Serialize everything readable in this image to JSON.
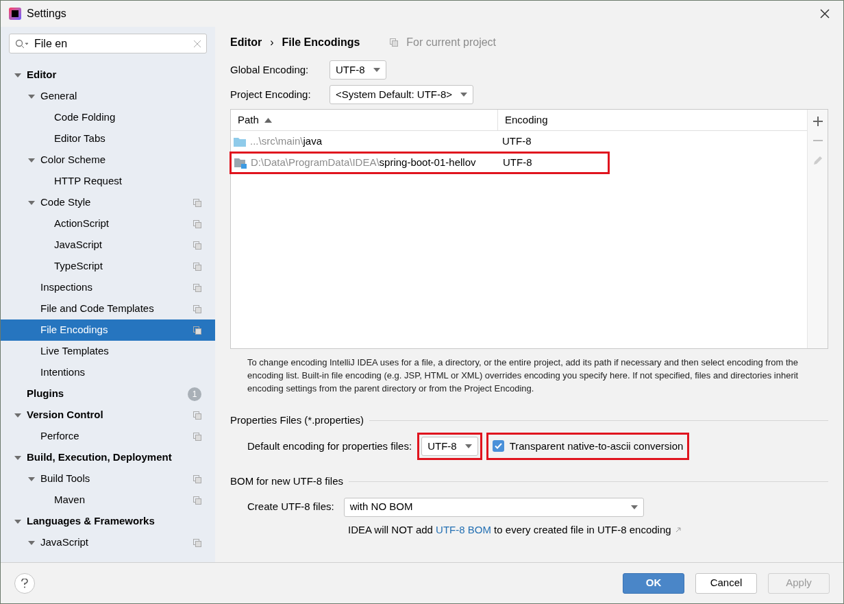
{
  "window": {
    "title": "Settings"
  },
  "search": {
    "value": "File en"
  },
  "tree": [
    {
      "label": "Editor",
      "bold": true,
      "expanded": true,
      "selected": false,
      "project_scope": false,
      "children": [
        {
          "label": "General",
          "expanded": true,
          "selected": false,
          "project_scope": false,
          "children": [
            {
              "label": "Code Folding",
              "selected": false,
              "project_scope": false
            },
            {
              "label": "Editor Tabs",
              "selected": false,
              "project_scope": false
            }
          ]
        },
        {
          "label": "Color Scheme",
          "expanded": true,
          "selected": false,
          "project_scope": false,
          "children": [
            {
              "label": "HTTP Request",
              "selected": false,
              "project_scope": false
            }
          ]
        },
        {
          "label": "Code Style",
          "expanded": true,
          "selected": false,
          "project_scope": true,
          "children": [
            {
              "label": "ActionScript",
              "selected": false,
              "project_scope": true
            },
            {
              "label": "JavaScript",
              "selected": false,
              "project_scope": true
            },
            {
              "label": "TypeScript",
              "selected": false,
              "project_scope": true
            }
          ]
        },
        {
          "label": "Inspections",
          "selected": false,
          "project_scope": true
        },
        {
          "label": "File and Code Templates",
          "selected": false,
          "project_scope": true
        },
        {
          "label": "File Encodings",
          "selected": true,
          "project_scope": true
        },
        {
          "label": "Live Templates",
          "selected": false,
          "project_scope": false
        },
        {
          "label": "Intentions",
          "selected": false,
          "project_scope": false
        }
      ]
    },
    {
      "label": "Plugins",
      "bold": true,
      "selected": false,
      "project_scope": false,
      "badge": "1"
    },
    {
      "label": "Version Control",
      "bold": true,
      "expanded": true,
      "selected": false,
      "project_scope": true,
      "children": [
        {
          "label": "Perforce",
          "selected": false,
          "project_scope": true
        }
      ]
    },
    {
      "label": "Build, Execution, Deployment",
      "bold": true,
      "expanded": true,
      "selected": false,
      "project_scope": false,
      "children": [
        {
          "label": "Build Tools",
          "expanded": true,
          "selected": false,
          "project_scope": true,
          "children": [
            {
              "label": "Maven",
              "selected": false,
              "project_scope": true
            }
          ]
        }
      ]
    },
    {
      "label": "Languages & Frameworks",
      "bold": true,
      "expanded": true,
      "selected": false,
      "project_scope": false,
      "children": [
        {
          "label": "JavaScript",
          "expanded": true,
          "selected": false,
          "project_scope": true
        }
      ]
    }
  ],
  "breadcrumb": [
    "Editor",
    "File Encodings"
  ],
  "breadcrumb_separator": "›",
  "scope_note": "For current project",
  "global_encoding": {
    "label": "Global Encoding:",
    "value": "UTF-8"
  },
  "project_encoding": {
    "label": "Project Encoding:",
    "value": "<System Default: UTF-8>"
  },
  "table": {
    "columns": [
      {
        "label": "Path",
        "sorted": true
      },
      {
        "label": "Encoding",
        "sorted": false
      }
    ],
    "rows": [
      {
        "kind": "folder",
        "path_prefix": "...\\src\\main\\",
        "path_name": "java",
        "encoding": "UTF-8",
        "highlighted": false
      },
      {
        "kind": "module",
        "path_prefix": "D:\\Data\\ProgramData\\IDEA\\",
        "path_name": "spring-boot-01-hellov",
        "encoding": "UTF-8",
        "highlighted": true
      }
    ]
  },
  "help_text": "To change encoding IntelliJ IDEA uses for a file, a directory, or the entire project, add its path if necessary and then select encoding from the encoding list. Built-in file encoding (e.g. JSP, HTML or XML) overrides encoding you specify here. If not specified, files and directories inherit encoding settings from the parent directory or from the Project Encoding.",
  "properties": {
    "title": "Properties Files (*.properties)",
    "label": "Default encoding for properties files:",
    "value": "UTF-8",
    "value_highlighted": true,
    "checkbox": {
      "label": "Transparent native-to-ascii conversion",
      "checked": true,
      "highlighted": true
    }
  },
  "bom": {
    "title": "BOM for new UTF-8 files",
    "label": "Create UTF-8 files:",
    "value": "with NO BOM",
    "note_before": "IDEA will NOT add ",
    "note_link": "UTF-8 BOM",
    "note_after": " to every created file in UTF-8 encoding"
  },
  "buttons": [
    {
      "label": "OK",
      "kind": "primary",
      "disabled": false
    },
    {
      "label": "Cancel",
      "kind": "normal",
      "disabled": false
    },
    {
      "label": "Apply",
      "kind": "normal",
      "disabled": true
    }
  ]
}
